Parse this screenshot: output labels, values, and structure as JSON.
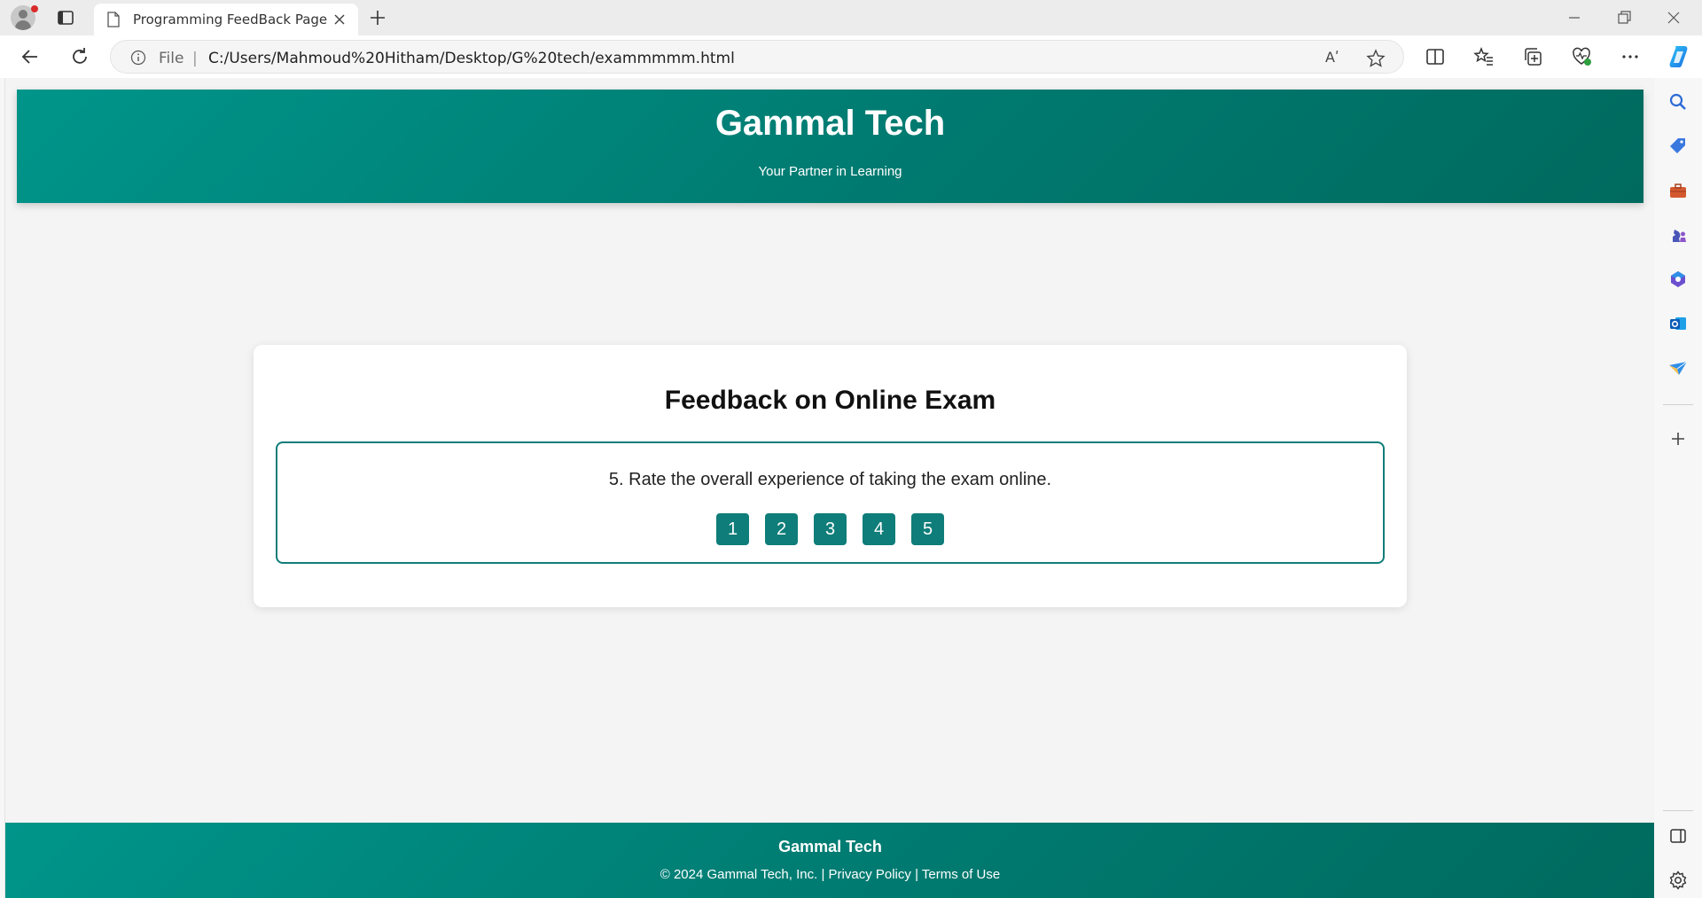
{
  "browser": {
    "tab": {
      "title": "Programming FeedBack Page"
    },
    "address": {
      "scheme_label": "File",
      "separator": "|",
      "url": "C:/Users/Mahmoud%20Hitham/Desktop/G%20tech/exammmmm.html",
      "read_aloud_glyph": "Aʹ"
    },
    "colors": {
      "copilot_accent": "#1f6fe5",
      "profile_dot": "#d92b2b"
    }
  },
  "header": {
    "title": "Gammal Tech",
    "tagline": "Your Partner in Learning"
  },
  "feedback": {
    "title": "Feedback on Online Exam",
    "question": "5. Rate the overall experience of taking the exam online.",
    "ratings": [
      "1",
      "2",
      "3",
      "4",
      "5"
    ]
  },
  "footer": {
    "brand": "Gammal Tech",
    "copyright": "© 2024 Gammal Tech, Inc.",
    "separator": "|",
    "privacy": "Privacy Policy",
    "terms": "Terms of Use"
  },
  "theme": {
    "primary": "#0f7d79",
    "header_gradient_start": "#00958a",
    "header_gradient_end": "#006a5e",
    "page_background": "#f4f4f4"
  }
}
